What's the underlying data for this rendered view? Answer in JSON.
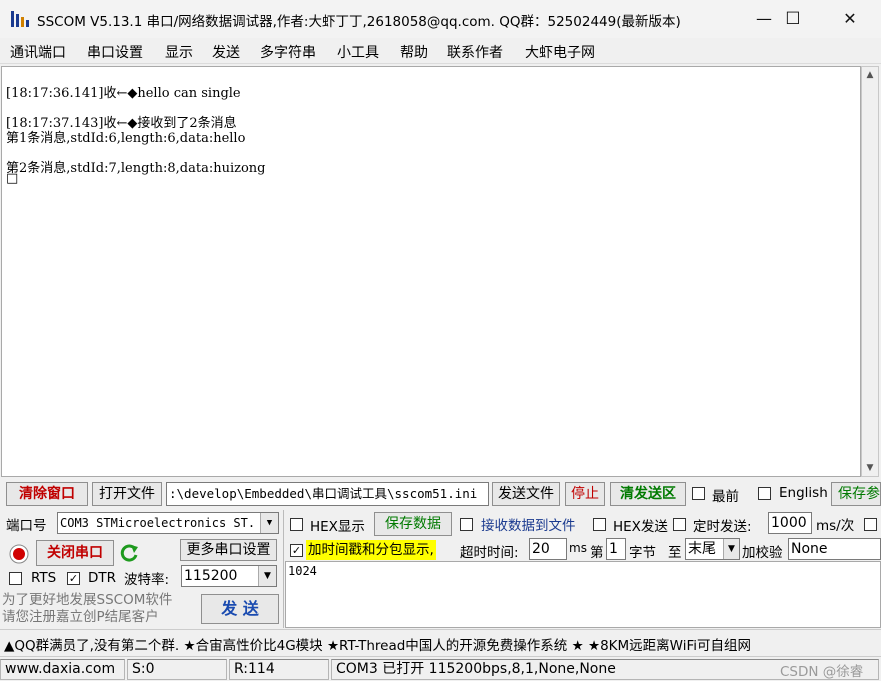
{
  "window": {
    "title": "SSCOM V5.13.1 串口/网络数据调试器,作者:大虾丁丁,2618058@qq.com. QQ群：52502449(最新版本)",
    "minimize_glyph": "—",
    "maximize_glyph": "☐",
    "close_glyph": "✕"
  },
  "menu": [
    "通讯端口",
    "串口设置",
    "显示",
    "发送",
    "多字符串",
    "小工具",
    "帮助",
    "联系作者",
    "大虾电子网"
  ],
  "receive": {
    "lines": [
      "[18:17:36.141]收←◆hello can single",
      "",
      "[18:17:37.143]收←◆接收到了2条消息",
      "第1条消息,stdId:6,length:6,data:hello",
      "",
      "第2条消息,stdId:7,length:8,data:huizong",
      "□"
    ]
  },
  "toolbar": {
    "clear_window": "清除窗口",
    "open_file": "打开文件",
    "file_path": ":\\develop\\Embedded\\串口调试工具\\sscom51.ini",
    "send_file": "发送文件",
    "stop": "停止",
    "clear_send": "清发送区",
    "topmost": "最前",
    "english": "English",
    "save_params": "保存参"
  },
  "port": {
    "port_label": "端口号",
    "port_value": "COM3 STMicroelectronics ST.",
    "close_port": "关闭串口",
    "more_settings": "更多串口设置",
    "rts": "RTS",
    "dtr": "DTR",
    "baud_label": "波特率:",
    "baud_value": "115200"
  },
  "options": {
    "hex_display": "HEX显示",
    "save_data": "保存数据",
    "recv_to_file": "接收数据到文件",
    "hex_send": "HEX发送",
    "timed_send": "定时发送:",
    "interval": "1000",
    "interval_unit": "ms/次",
    "timestamp": "加时间戳和分包显示,",
    "timeout_label": "超时时间:",
    "timeout_value": "20",
    "timeout_unit": "ms",
    "byte_prefix": "第",
    "byte_value": "1",
    "byte_suffix": "字节",
    "to_label": "至",
    "to_value": "末尾",
    "checksum_label": "加校验",
    "checksum_value": "None"
  },
  "send": {
    "text": "1024",
    "send_button": "发  送"
  },
  "promo": {
    "line1": "为了更好地发展SSCOM软件",
    "line2": "请您注册嘉立创P结尾客户"
  },
  "ticker": "▲QQ群满员了,没有第二个群.  ★合宙高性价比4G模块  ★RT-Thread中国人的开源免费操作系统  ★  ★8KM远距离WiFi可自组网",
  "status": {
    "site": "www.daxia.com",
    "sent": "S:0",
    "received": "R:114",
    "port_status": "COM3 已打开  115200bps,8,1,None,None",
    "watermark": "CSDN @徐睿"
  },
  "colors": {
    "clear_window_text": "#c00000",
    "stop_text": "#c00000",
    "clear_send_text": "#007a00",
    "timestamp_highlight": "#ffff00",
    "port_icon": "#d00000"
  }
}
